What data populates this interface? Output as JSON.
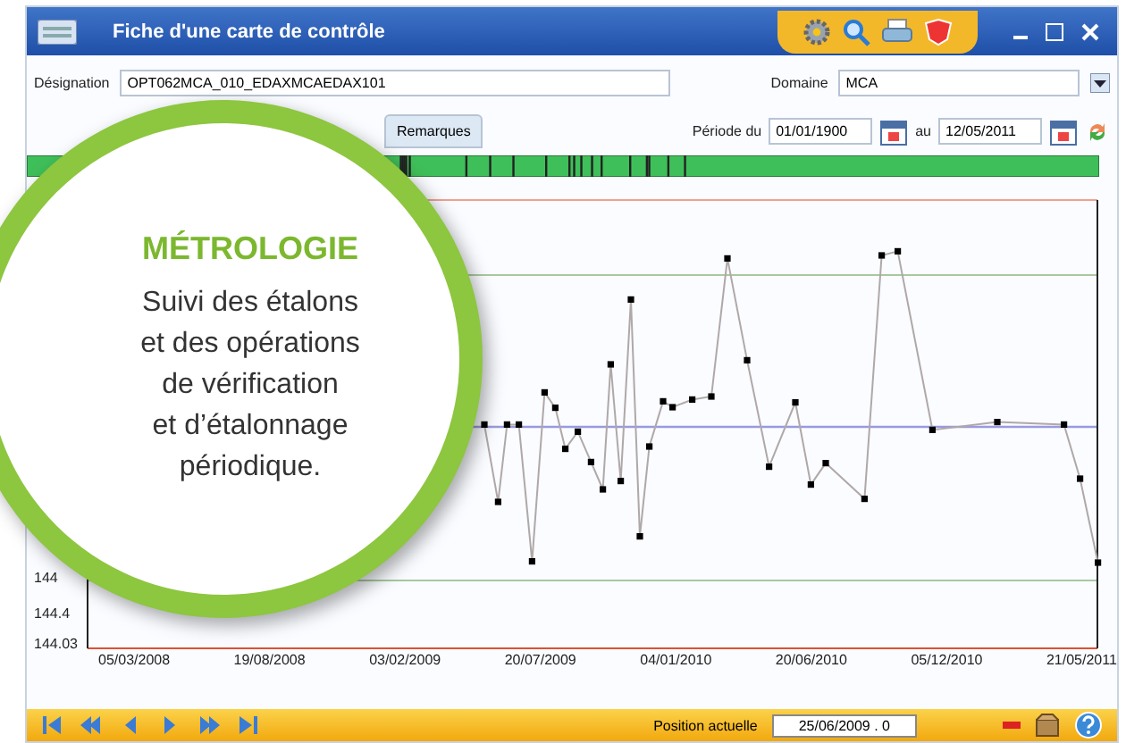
{
  "window": {
    "title": "Fiche d'une carte de contrôle"
  },
  "fields": [
    {
      "label": "Désignation",
      "value": "OPT062MCA_010_EDAXMCAEDAX101"
    },
    {
      "label": "Domaine",
      "value": "MCA"
    }
  ],
  "tabs": [
    {
      "label": "Remarques",
      "selected": false
    }
  ],
  "period": {
    "from_label": "Période du",
    "from": "01/01/1900",
    "to_label": "au",
    "to": "12/05/2011"
  },
  "chart": {
    "y_labels": [
      "144",
      "144.4",
      "144.03"
    ],
    "x_labels": [
      "05/03/2008",
      "19/08/2008",
      "03/02/2009",
      "20/07/2009",
      "04/01/2010",
      "20/06/2010",
      "05/12/2010",
      "21/05/2011"
    ]
  },
  "footer": {
    "position_label": "Position actuelle",
    "position_value": "25/06/2009 . 0"
  },
  "overlay": {
    "heading": "MÉTROLOGIE",
    "lines": [
      "Suivi des étalons",
      "et des opérations",
      "de vérification",
      "et d’étalonnage",
      "périodique."
    ]
  }
}
